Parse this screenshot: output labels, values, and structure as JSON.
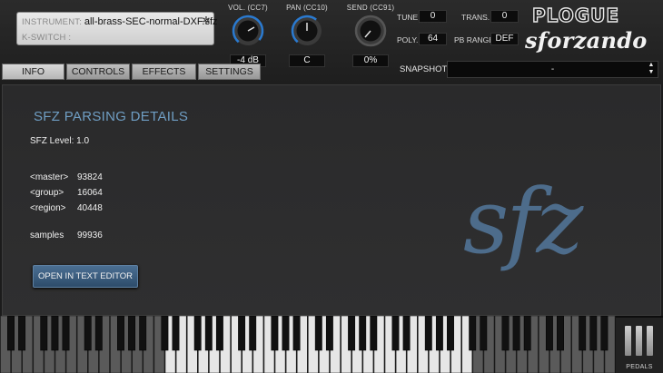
{
  "instrument": {
    "instrument_label": "INSTRUMENT:",
    "instrument_value": "all-brass-SEC-normal-DXF.sfz",
    "kswitch_label": "K-SWITCH :",
    "kswitch_value": "",
    "settings_icon": "gear-icon"
  },
  "knobs": [
    {
      "label": "VOL. (CC7)",
      "value": "-4 dB"
    },
    {
      "label": "PAN (CC10)",
      "value": "C"
    },
    {
      "label": "SEND (CC91)",
      "value": "0%"
    }
  ],
  "params": {
    "tune_label": "TUNE",
    "tune_value": "0",
    "trans_label": "TRANS.",
    "trans_value": "0",
    "poly_label": "POLY.",
    "poly_value": "64",
    "pbrange_label": "PB RANGE",
    "pbrange_value": "DEF"
  },
  "logo": {
    "brand": "PLOGUE",
    "product": "sforzando"
  },
  "tabs": [
    {
      "label": "INFO",
      "active": true
    },
    {
      "label": "CONTROLS",
      "active": false
    },
    {
      "label": "EFFECTS",
      "active": false
    },
    {
      "label": "SETTINGS",
      "active": false
    }
  ],
  "snapshot": {
    "label": "SNAPSHOT",
    "value": "-"
  },
  "info": {
    "title": "SFZ PARSING DETAILS",
    "sfz_level_label": "SFZ Level:",
    "sfz_level_value": "1.0",
    "master_label": "<master>",
    "master_value": "93824",
    "group_label": "<group>",
    "group_value": "16064",
    "region_label": "<region>",
    "region_value": "40448",
    "samples_label": "samples",
    "samples_value": "99936",
    "open_button": "OPEN IN TEXT EDITOR",
    "watermark": "sfz"
  },
  "keyboard": {
    "pedals_label": "PEDALS"
  },
  "colors": {
    "accent_blue": "#6f9ec4",
    "button_blue": "#3b5f82",
    "watermark_blue": "#4d6c8b"
  }
}
